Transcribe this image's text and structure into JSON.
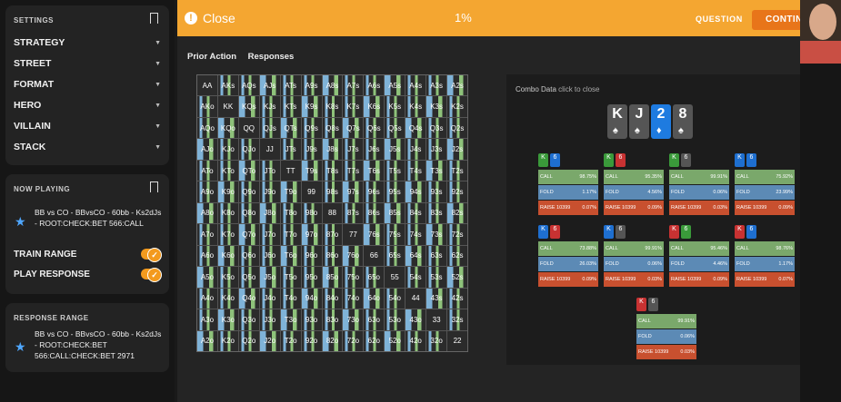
{
  "sidebar": {
    "settings_title": "SETTINGS",
    "menu": [
      "STRATEGY",
      "STREET",
      "FORMAT",
      "HERO",
      "VILLAIN",
      "STACK"
    ],
    "now_playing_title": "NOW PLAYING",
    "now_playing": "BB vs CO - BBvsCO - 60bb - Ks2dJs - ROOT:CHECK:BET 566:CALL",
    "train_range": "TRAIN RANGE",
    "play_response": "PLAY RESPONSE",
    "response_title": "RESPONSE RANGE",
    "response": "BB vs CO - BBvsCO - 60bb - Ks2dJs - ROOT:CHECK:BET 566:CALL:CHECK:BET 2971"
  },
  "topbar": {
    "close": "Close",
    "progress": "1%",
    "question": "QUESTION",
    "continue": "CONTINUE"
  },
  "tabs": [
    "Prior Action",
    "Responses"
  ],
  "grid": [
    [
      "AA",
      "AKs",
      "AQs",
      "AJs",
      "ATs",
      "A9s",
      "A8s",
      "A7s",
      "A6s",
      "A5s",
      "A4s",
      "A3s",
      "A2s"
    ],
    [
      "AKo",
      "KK",
      "KQs",
      "KJs",
      "KTs",
      "K9s",
      "K8s",
      "K7s",
      "K6s",
      "K5s",
      "K4s",
      "K3s",
      "K2s"
    ],
    [
      "AQo",
      "KQo",
      "QQ",
      "QJs",
      "QTs",
      "Q9s",
      "Q8s",
      "Q7s",
      "Q6s",
      "Q5s",
      "Q4s",
      "Q3s",
      "Q2s"
    ],
    [
      "AJo",
      "KJo",
      "QJo",
      "JJ",
      "JTs",
      "J9s",
      "J8s",
      "J7s",
      "J6s",
      "J5s",
      "J4s",
      "J3s",
      "J2s"
    ],
    [
      "ATo",
      "KTo",
      "QTo",
      "JTo",
      "TT",
      "T9s",
      "T8s",
      "T7s",
      "T6s",
      "T5s",
      "T4s",
      "T3s",
      "T2s"
    ],
    [
      "A9o",
      "K9o",
      "Q9o",
      "J9o",
      "T9o",
      "99",
      "98s",
      "97s",
      "96s",
      "95s",
      "94s",
      "93s",
      "92s"
    ],
    [
      "A8o",
      "K8o",
      "Q8o",
      "J8o",
      "T8o",
      "98o",
      "88",
      "87s",
      "86s",
      "85s",
      "84s",
      "83s",
      "82s"
    ],
    [
      "A7o",
      "K7o",
      "Q7o",
      "J7o",
      "T7o",
      "97o",
      "87o",
      "77",
      "76s",
      "75s",
      "74s",
      "73s",
      "72s"
    ],
    [
      "A6o",
      "K6o",
      "Q6o",
      "J6o",
      "T6o",
      "96o",
      "86o",
      "76o",
      "66",
      "65s",
      "64s",
      "63s",
      "62s"
    ],
    [
      "A5o",
      "K5o",
      "Q5o",
      "J5o",
      "T5o",
      "95o",
      "85o",
      "75o",
      "65o",
      "55",
      "54s",
      "53s",
      "52s"
    ],
    [
      "A4o",
      "K4o",
      "Q4o",
      "J4o",
      "T4o",
      "94o",
      "84o",
      "74o",
      "64o",
      "54o",
      "44",
      "43s",
      "42s"
    ],
    [
      "A3o",
      "K3o",
      "Q3o",
      "J3o",
      "T3o",
      "93o",
      "83o",
      "73o",
      "63o",
      "53o",
      "43o",
      "33",
      "32s"
    ],
    [
      "A2o",
      "K2o",
      "Q2o",
      "J2o",
      "T2o",
      "92o",
      "82o",
      "72o",
      "62o",
      "52o",
      "42o",
      "32o",
      "22"
    ]
  ],
  "combo": {
    "title": "Combo Data",
    "hint": "click to close",
    "board": [
      {
        "rank": "K",
        "suit": "♠",
        "color": "#555"
      },
      {
        "rank": "J",
        "suit": "♠",
        "color": "#555"
      },
      {
        "rank": "2",
        "suit": "♦",
        "color": "#1e7be0"
      },
      {
        "rank": "8",
        "suit": "♠",
        "color": "#555"
      }
    ],
    "boxes": [
      {
        "c1": {
          "r": "K",
          "c": "#3a9a3a"
        },
        "c2": {
          "r": "6",
          "c": "#1e6fd0"
        },
        "call": "98.75%",
        "fold": "1.17%",
        "raise": "0.07%"
      },
      {
        "c1": {
          "r": "K",
          "c": "#3a9a3a"
        },
        "c2": {
          "r": "6",
          "c": "#c83232"
        },
        "call": "95.35%",
        "fold": "4.56%",
        "raise": "0.09%"
      },
      {
        "c1": {
          "r": "K",
          "c": "#3a9a3a"
        },
        "c2": {
          "r": "6",
          "c": "#555"
        },
        "call": "99.91%",
        "fold": "0.06%",
        "raise": "0.03%"
      },
      {
        "c1": {
          "r": "K",
          "c": "#1e6fd0"
        },
        "c2": {
          "r": "6",
          "c": "#1e6fd0"
        },
        "call": "75.92%",
        "fold": "23.99%",
        "raise": "0.09%"
      },
      {
        "c1": {
          "r": "K",
          "c": "#1e6fd0"
        },
        "c2": {
          "r": "6",
          "c": "#c83232"
        },
        "call": "73.88%",
        "fold": "26.03%",
        "raise": "0.09%"
      },
      {
        "c1": {
          "r": "K",
          "c": "#1e6fd0"
        },
        "c2": {
          "r": "6",
          "c": "#555"
        },
        "call": "99.91%",
        "fold": "0.06%",
        "raise": "0.03%"
      },
      {
        "c1": {
          "r": "K",
          "c": "#c83232"
        },
        "c2": {
          "r": "6",
          "c": "#3a9a3a"
        },
        "call": "95.46%",
        "fold": "4.46%",
        "raise": "0.09%"
      },
      {
        "c1": {
          "r": "K",
          "c": "#c83232"
        },
        "c2": {
          "r": "6",
          "c": "#1e6fd0"
        },
        "call": "98.76%",
        "fold": "1.17%",
        "raise": "0.07%"
      },
      {
        "c1": {
          "r": "K",
          "c": "#c83232"
        },
        "c2": {
          "r": "6",
          "c": "#555"
        },
        "call": "99.91%",
        "fold": "0.06%",
        "raise": "0.03%"
      }
    ],
    "labels": {
      "call": "CALL",
      "fold": "FOLD",
      "raise": "RAISE 10399"
    }
  }
}
